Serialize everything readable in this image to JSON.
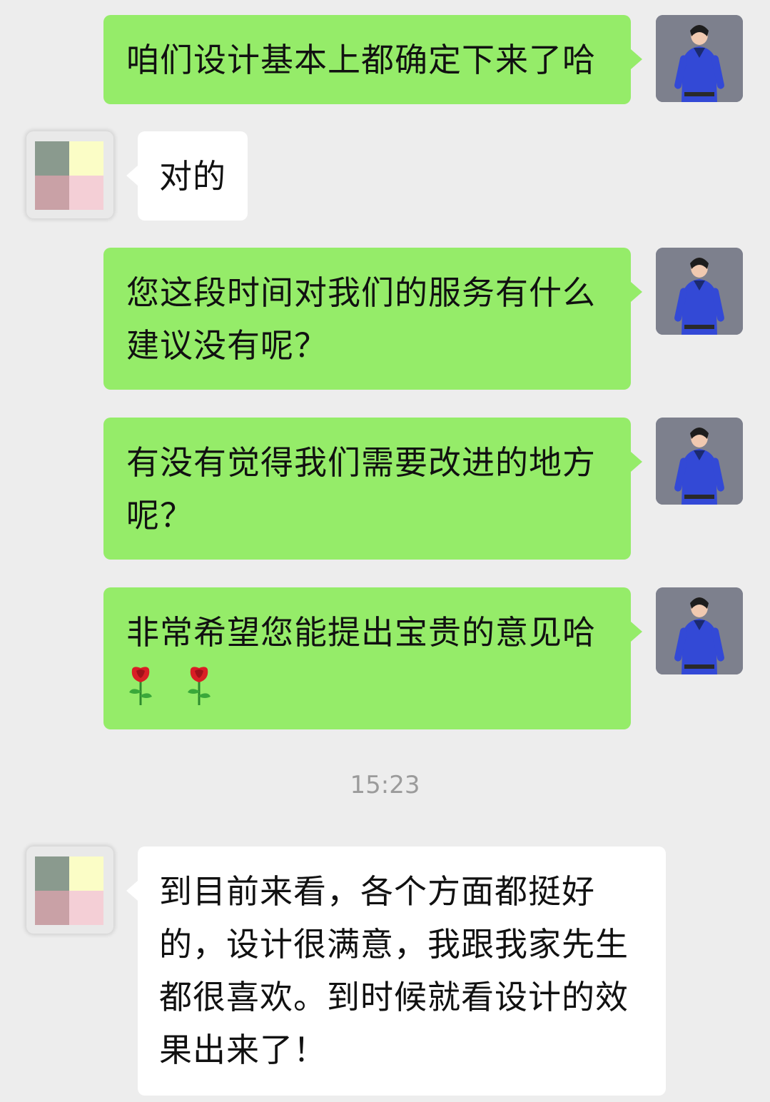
{
  "messages": [
    {
      "sender": "self",
      "text": "咱们设计基本上都确定下来了哈"
    },
    {
      "sender": "other",
      "text": "对的"
    },
    {
      "sender": "self",
      "text": "您这段时间对我们的服务有什么\n建议没有呢？"
    },
    {
      "sender": "self",
      "text": "有没有觉得我们需要改进的地方\n呢？"
    },
    {
      "sender": "self",
      "text": "非常希望您能提出宝贵的意见哈",
      "emoji": [
        "rose-icon",
        "rose-icon"
      ]
    },
    {
      "sender": "other",
      "text": "到目前来看，各个方面都挺好\n的，设计很满意，我跟我家先生\n都很喜欢。到时候就看设计的效\n果出来了！"
    }
  ],
  "timestamp": "15:23",
  "colors": {
    "self_bubble": "#95ec69",
    "other_bubble": "#ffffff",
    "background": "#ededed",
    "timestamp": "#9b9b9b"
  }
}
